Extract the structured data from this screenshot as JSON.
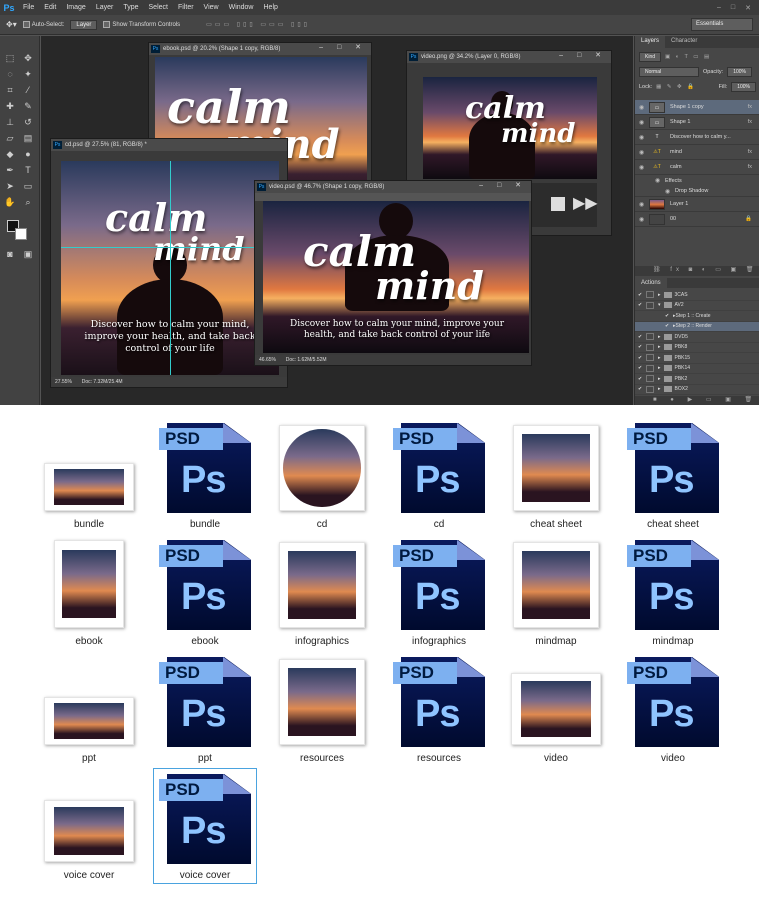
{
  "app": {
    "logo": "Ps",
    "menus": [
      "File",
      "Edit",
      "Image",
      "Layer",
      "Type",
      "Select",
      "Filter",
      "View",
      "Window",
      "Help"
    ],
    "window_controls": [
      "–",
      "□",
      "✕"
    ]
  },
  "options": {
    "auto_select": "Auto-Select:",
    "auto_select_value": "Layer",
    "transform": "Show Transform Controls",
    "workspace": "Essentials"
  },
  "docs": {
    "ebook": {
      "title": "ebook.psd @ 20.2% (Shape 1 copy, RGB/8)"
    },
    "video_png": {
      "title": "video.png @ 34.2% (Layer 0, RGB/8)"
    },
    "cd": {
      "title": "cd.psd @ 27.5% (81, RGB/8) *",
      "zoom": "27.55%",
      "doc": "Doc: 7.32M/25.4M"
    },
    "video_psd": {
      "title": "video.psd @ 46.7% (Shape 1 copy, RGB/8)",
      "zoom": "46.65%",
      "doc": "Doc: 1.62M/5.52M"
    }
  },
  "artwork": {
    "calm": "calm",
    "mind": "mind",
    "tagline": "Discover how to calm your mind, improve your health, and take back control of your life"
  },
  "layers_panel": {
    "tabs": [
      "Layers",
      "Character"
    ],
    "kind": "Kind",
    "blend": "Normal",
    "opacity_label": "Opacity:",
    "opacity": "100%",
    "lock_label": "Lock:",
    "fill_label": "Fill:",
    "fill": "100%",
    "layers": [
      {
        "name": "Shape 1 copy",
        "type": "shape",
        "fx": "fx"
      },
      {
        "name": "Shape 1",
        "type": "shape",
        "fx": "fx"
      },
      {
        "name": "Discover how to calm y...",
        "type": "text",
        "fx": ""
      },
      {
        "name": "mind",
        "type": "warn",
        "fx": "fx"
      },
      {
        "name": "calm",
        "type": "warn",
        "fx": "fx"
      },
      {
        "name": "Effects",
        "type": "effects",
        "fx": ""
      },
      {
        "name": "Drop Shadow",
        "type": "effect",
        "fx": ""
      },
      {
        "name": "Layer 1",
        "type": "image",
        "fx": ""
      },
      {
        "name": "00",
        "type": "image",
        "fx": ""
      }
    ]
  },
  "actions_panel": {
    "tab": "Actions",
    "items": [
      "3CAS",
      "AV2",
      "Step 1 :: Create",
      "Step 2 :: Render",
      "DVD5",
      "PBK8",
      "PBK15",
      "PBK14",
      "PBK2",
      "BOX2"
    ]
  },
  "files": [
    {
      "label": "bundle",
      "kind": "thumb"
    },
    {
      "label": "bundle",
      "kind": "psd"
    },
    {
      "label": "cd",
      "kind": "thumb"
    },
    {
      "label": "cd",
      "kind": "psd"
    },
    {
      "label": "cheat sheet",
      "kind": "thumb"
    },
    {
      "label": "cheat sheet",
      "kind": "psd"
    },
    {
      "label": "ebook",
      "kind": "thumb"
    },
    {
      "label": "ebook",
      "kind": "psd"
    },
    {
      "label": "infographics",
      "kind": "thumb"
    },
    {
      "label": "infographics",
      "kind": "psd"
    },
    {
      "label": "mindmap",
      "kind": "thumb"
    },
    {
      "label": "mindmap",
      "kind": "psd"
    },
    {
      "label": "ppt",
      "kind": "thumb"
    },
    {
      "label": "ppt",
      "kind": "psd"
    },
    {
      "label": "resources",
      "kind": "thumb"
    },
    {
      "label": "resources",
      "kind": "psd"
    },
    {
      "label": "video",
      "kind": "thumb"
    },
    {
      "label": "video",
      "kind": "psd"
    },
    {
      "label": "voice cover",
      "kind": "thumb"
    },
    {
      "label": "voice cover",
      "kind": "psd"
    }
  ],
  "psd_badge": "PSD",
  "ps_glyph": "Ps"
}
